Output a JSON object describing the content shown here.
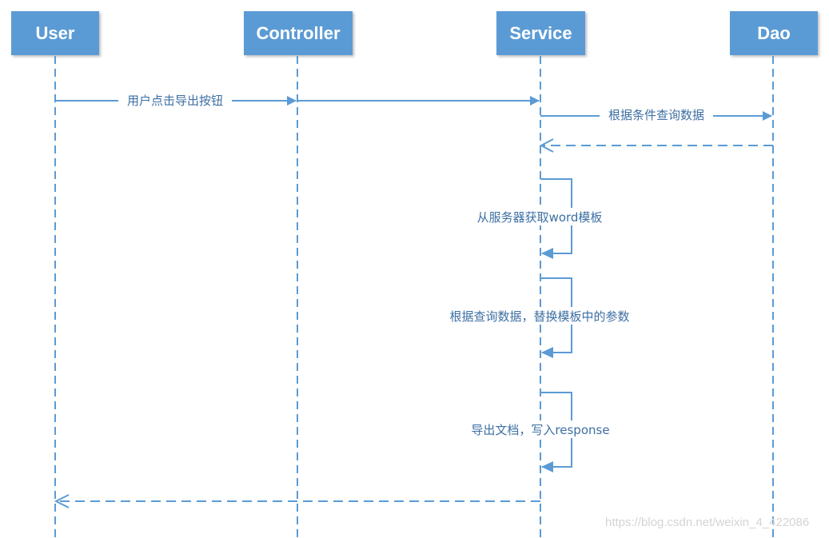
{
  "actors": {
    "user": "User",
    "controller": "Controller",
    "service": "Service",
    "dao": "Dao"
  },
  "messages": {
    "click_export": "用户点击导出按钮",
    "query_by_condition": "根据条件查询数据",
    "get_template": "从服务器获取word模板",
    "replace_params": "根据查询数据，替换模板中的参数",
    "export_doc": "导出文档，写入response"
  },
  "watermark": "https://blog.csdn.net/weixin_4_422086",
  "colors": {
    "actor_fill": "#5b9bd5",
    "line": "#5b9bd5",
    "label_text": "#3d6fa3"
  }
}
